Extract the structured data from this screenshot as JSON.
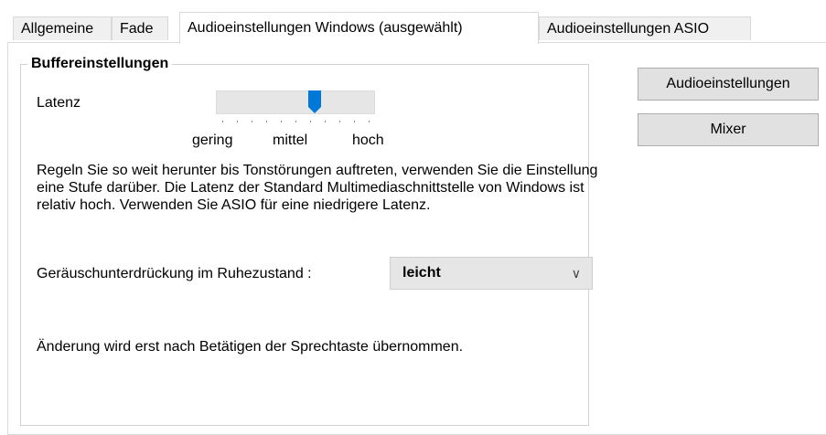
{
  "tabs": [
    {
      "label": "Allgemeine"
    },
    {
      "label": "Fade"
    },
    {
      "label": "Audioeinstellungen Windows (ausgewählt)"
    },
    {
      "label": "Audioeinstellungen ASIO"
    }
  ],
  "buffer": {
    "title": "Buffereinstellungen",
    "latency_label": "Latenz",
    "latency_value_fraction": 0.63,
    "scale_low": "gering",
    "scale_mid": "mittel",
    "scale_high": "hoch",
    "description": "Regeln Sie so weit  herunter bis Tonstörungen auftreten,  verwenden Sie die Einstellung eine Stufe darüber. Die Latenz der Standard Multimediaschnittstelle von Windows ist relativ hoch. Verwenden Sie ASIO für eine niedrigere Latenz.",
    "noise_label": "Geräuschunterdrückung im Ruhezustand :",
    "noise_value": "leicht",
    "note": "Änderung wird erst nach Betätigen der Sprechtaste übernommen."
  },
  "buttons": {
    "audio_settings": "Audioeinstellungen",
    "mixer": "Mixer"
  },
  "icons": {
    "dropdown": "chevron-down-icon"
  }
}
